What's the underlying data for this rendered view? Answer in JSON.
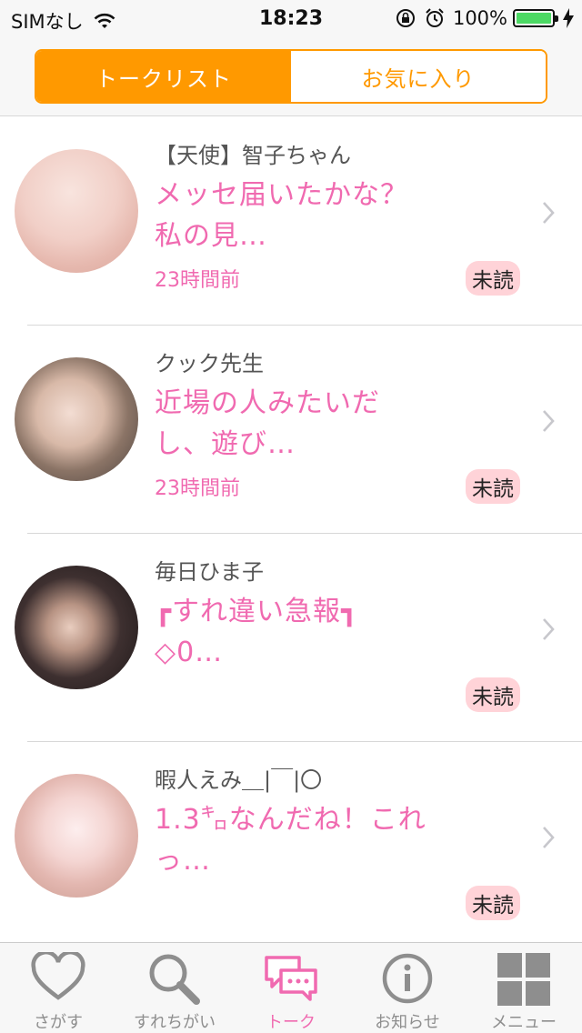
{
  "status_bar": {
    "carrier": "SIMなし",
    "time": "18:23",
    "battery_percent": "100%",
    "battery_level": 1.0
  },
  "segment": {
    "tabs": [
      {
        "label": "トークリスト",
        "active": true
      },
      {
        "label": "お気に入り",
        "active": false
      }
    ]
  },
  "conversations": [
    {
      "name": "【天使】智子ちゃん",
      "message_line1": "メッセ届いたかな？",
      "message_line2": "私の見…",
      "time": "23時間前",
      "badge": "未読",
      "avatar_icon": "user-photo"
    },
    {
      "name": "クック先生",
      "message_line1": "近場の人みたいだ",
      "message_line2": "し、遊び…",
      "time": "23時間前",
      "badge": "未読",
      "avatar_icon": "user-photo"
    },
    {
      "name": "毎日ひま子",
      "message_line1": "┏すれ違い急報┓",
      "message_line2": "◇0…",
      "time": "",
      "badge": "未読",
      "avatar_icon": "user-photo"
    },
    {
      "name": "暇人えみ＿|￣|〇",
      "message_line1": "1.3㌔なんだね！これ",
      "message_line2": "っ…",
      "time": "",
      "badge": "未読",
      "avatar_icon": "user-photo"
    }
  ],
  "tabbar": {
    "items": [
      {
        "label": "さがす",
        "icon": "heart-icon",
        "active": false
      },
      {
        "label": "すれちがい",
        "icon": "search-icon",
        "active": false
      },
      {
        "label": "トーク",
        "icon": "chat-icon",
        "active": true
      },
      {
        "label": "お知らせ",
        "icon": "info-icon",
        "active": false
      },
      {
        "label": "メニュー",
        "icon": "grid-menu-icon",
        "active": false
      }
    ]
  },
  "colors": {
    "accent_orange": "#ff9900",
    "pink": "#f06ab0",
    "badge_bg": "#ffd3d8",
    "battery_green": "#4cd964"
  }
}
